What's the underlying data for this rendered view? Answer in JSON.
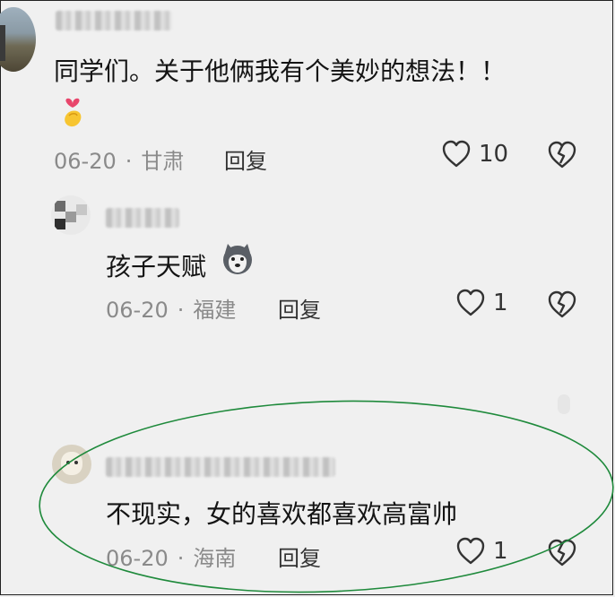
{
  "comments": [
    {
      "text": "同学们。关于他俩我有个美妙的想法！！",
      "date": "06-20",
      "location": "甘肃",
      "reply_label": "回复",
      "likes": "10"
    },
    {
      "text": "孩子天赋",
      "date": "06-20",
      "location": "福建",
      "reply_label": "回复",
      "likes": "1"
    },
    {
      "text": "不现实，女的喜欢都喜欢高富帅",
      "date": "06-20",
      "location": "海南",
      "reply_label": "回复",
      "likes": "1"
    }
  ],
  "separator": "·",
  "colors": {
    "oval": "#1f8a3c",
    "meta": "#8a8a8a",
    "background": "#f0f0f0"
  },
  "icons": [
    "heart-outline-icon",
    "broken-heart-icon",
    "heart-hand-emoji",
    "husky-emoji"
  ]
}
